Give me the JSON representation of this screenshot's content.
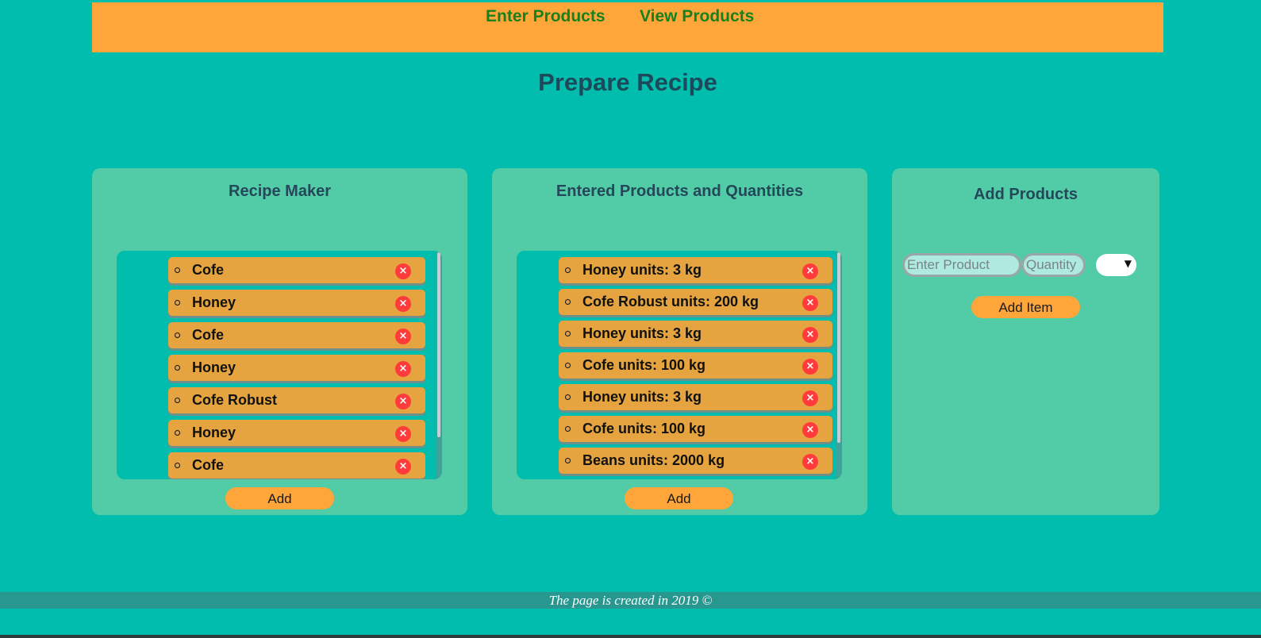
{
  "nav": {
    "enter_products": "Enter Products",
    "view_products": "View Products"
  },
  "page_title": "Prepare Recipe",
  "recipe_maker": {
    "title": "Recipe Maker",
    "items": [
      "Cofe",
      "Honey",
      "Cofe",
      "Honey",
      "Cofe Robust",
      "Honey",
      "Cofe"
    ],
    "add_label": "Add"
  },
  "entered_products": {
    "title": "Entered Products and Quantities",
    "items": [
      "Honey units: 3 kg",
      "Cofe Robust units: 200 kg",
      "Honey units: 3 kg",
      "Cofe units: 100 kg",
      "Honey units: 3 kg",
      "Cofe units: 100 kg",
      "Beans units: 2000 kg"
    ],
    "add_label": "Add"
  },
  "add_products": {
    "title": "Add Products",
    "product_placeholder": "Enter Product",
    "quantity_placeholder": "Quantity",
    "unit_select_value": "",
    "add_item_label": "Add Item"
  },
  "remove_icon_glyph": "×",
  "dropdown_glyph": "▼",
  "footer_text": "The page is created in 2019 ©",
  "colors": {
    "background": "#00bdad",
    "header": "#ffa63a",
    "nav_link": "#18801f",
    "panel": "#52cca6",
    "list_item": "#e5a43f",
    "remove_icon": "#ff3b3b",
    "footer": "#27978f"
  }
}
